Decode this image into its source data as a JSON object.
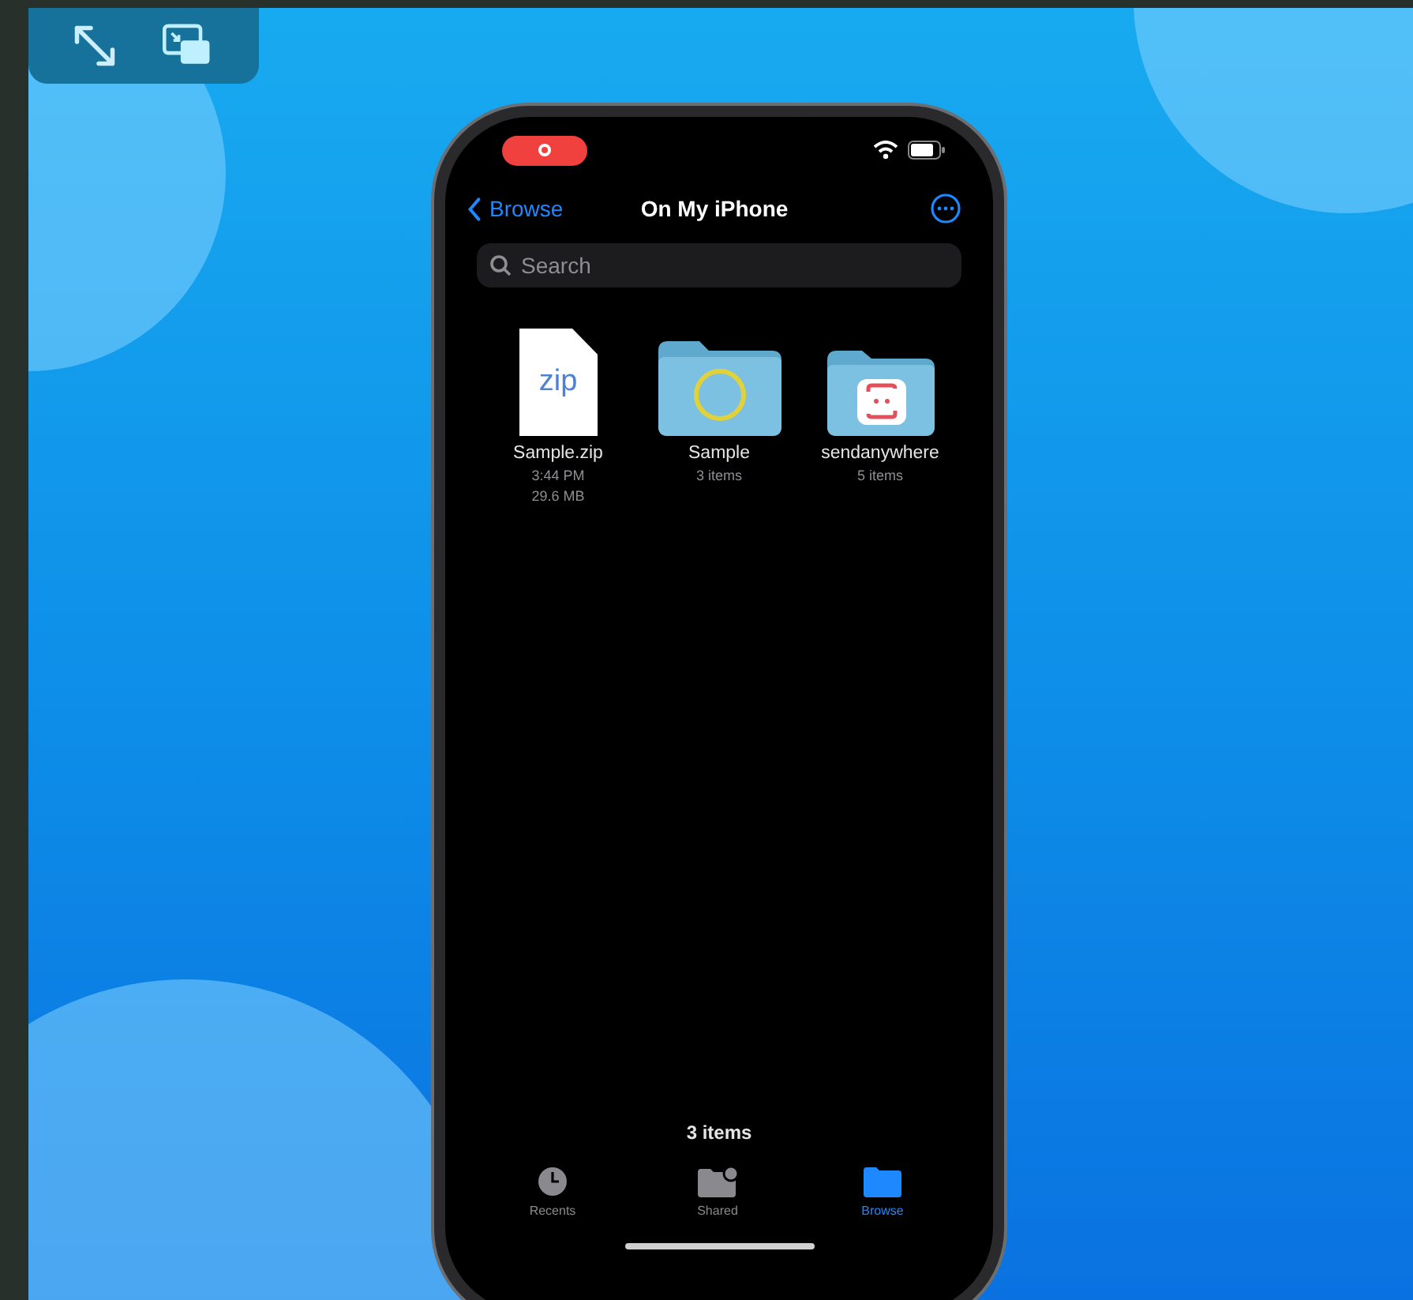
{
  "nav": {
    "back_label": "Browse",
    "title": "On My iPhone"
  },
  "search": {
    "placeholder": "Search"
  },
  "files": [
    {
      "kind": "zip",
      "name": "Sample.zip",
      "badge": "zip",
      "details": [
        "3:44 PM",
        "29.6 MB"
      ]
    },
    {
      "kind": "folder",
      "name": "Sample",
      "details": [
        "3 items"
      ]
    },
    {
      "kind": "app_folder",
      "name": "sendanywhere",
      "details": [
        "5 items"
      ]
    }
  ],
  "footer_count": "3 items",
  "tabs": [
    {
      "kind": "recents",
      "label": "Recents",
      "selected": false
    },
    {
      "kind": "shared",
      "label": "Shared",
      "selected": false
    },
    {
      "kind": "browse",
      "label": "Browse",
      "selected": true
    }
  ]
}
